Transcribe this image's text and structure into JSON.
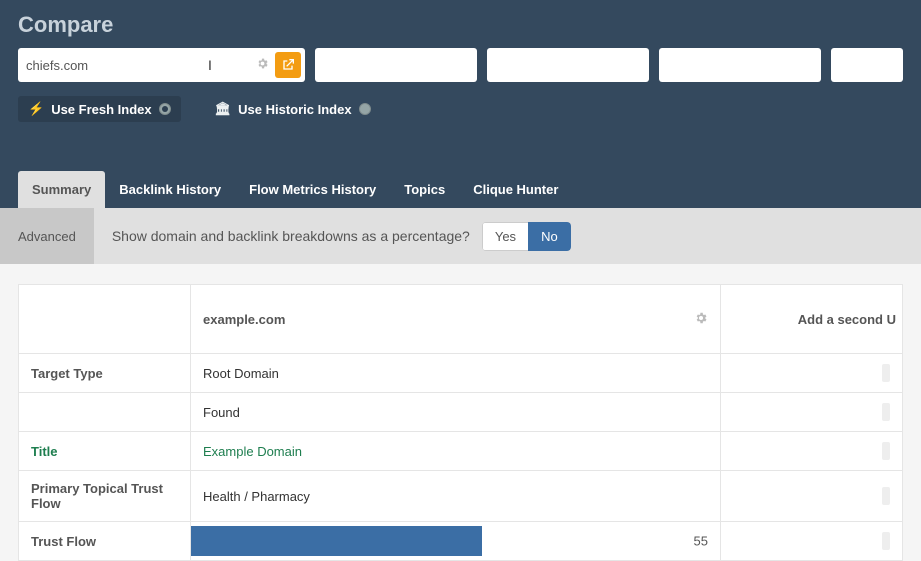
{
  "page_title": "Compare",
  "search": {
    "value": "chiefs.com"
  },
  "index_options": {
    "fresh": "Use Fresh Index",
    "historic": "Use Historic Index"
  },
  "tabs": {
    "summary": "Summary",
    "backlink_history": "Backlink History",
    "flow_metrics": "Flow Metrics History",
    "topics": "Topics",
    "clique": "Clique Hunter"
  },
  "options_bar": {
    "advanced": "Advanced",
    "question": "Show domain and backlink breakdowns as a percentage?",
    "yes": "Yes",
    "no": "No"
  },
  "columns": {
    "a_header": "example.com",
    "b_header": "Add a second U"
  },
  "rows": {
    "target_type": {
      "label": "Target Type",
      "value": "Root Domain"
    },
    "found": {
      "label": "",
      "value": "Found"
    },
    "title": {
      "label": "Title",
      "value": "Example Domain"
    },
    "primary_topic": {
      "label": "Primary Topical Trust Flow",
      "value": "Health / Pharmacy"
    },
    "trust_flow": {
      "label": "Trust Flow",
      "value": "55"
    }
  },
  "chart_data": {
    "type": "bar",
    "title": "Trust Flow",
    "categories": [
      "example.com"
    ],
    "values": [
      55
    ],
    "xlim": [
      0,
      100
    ]
  }
}
